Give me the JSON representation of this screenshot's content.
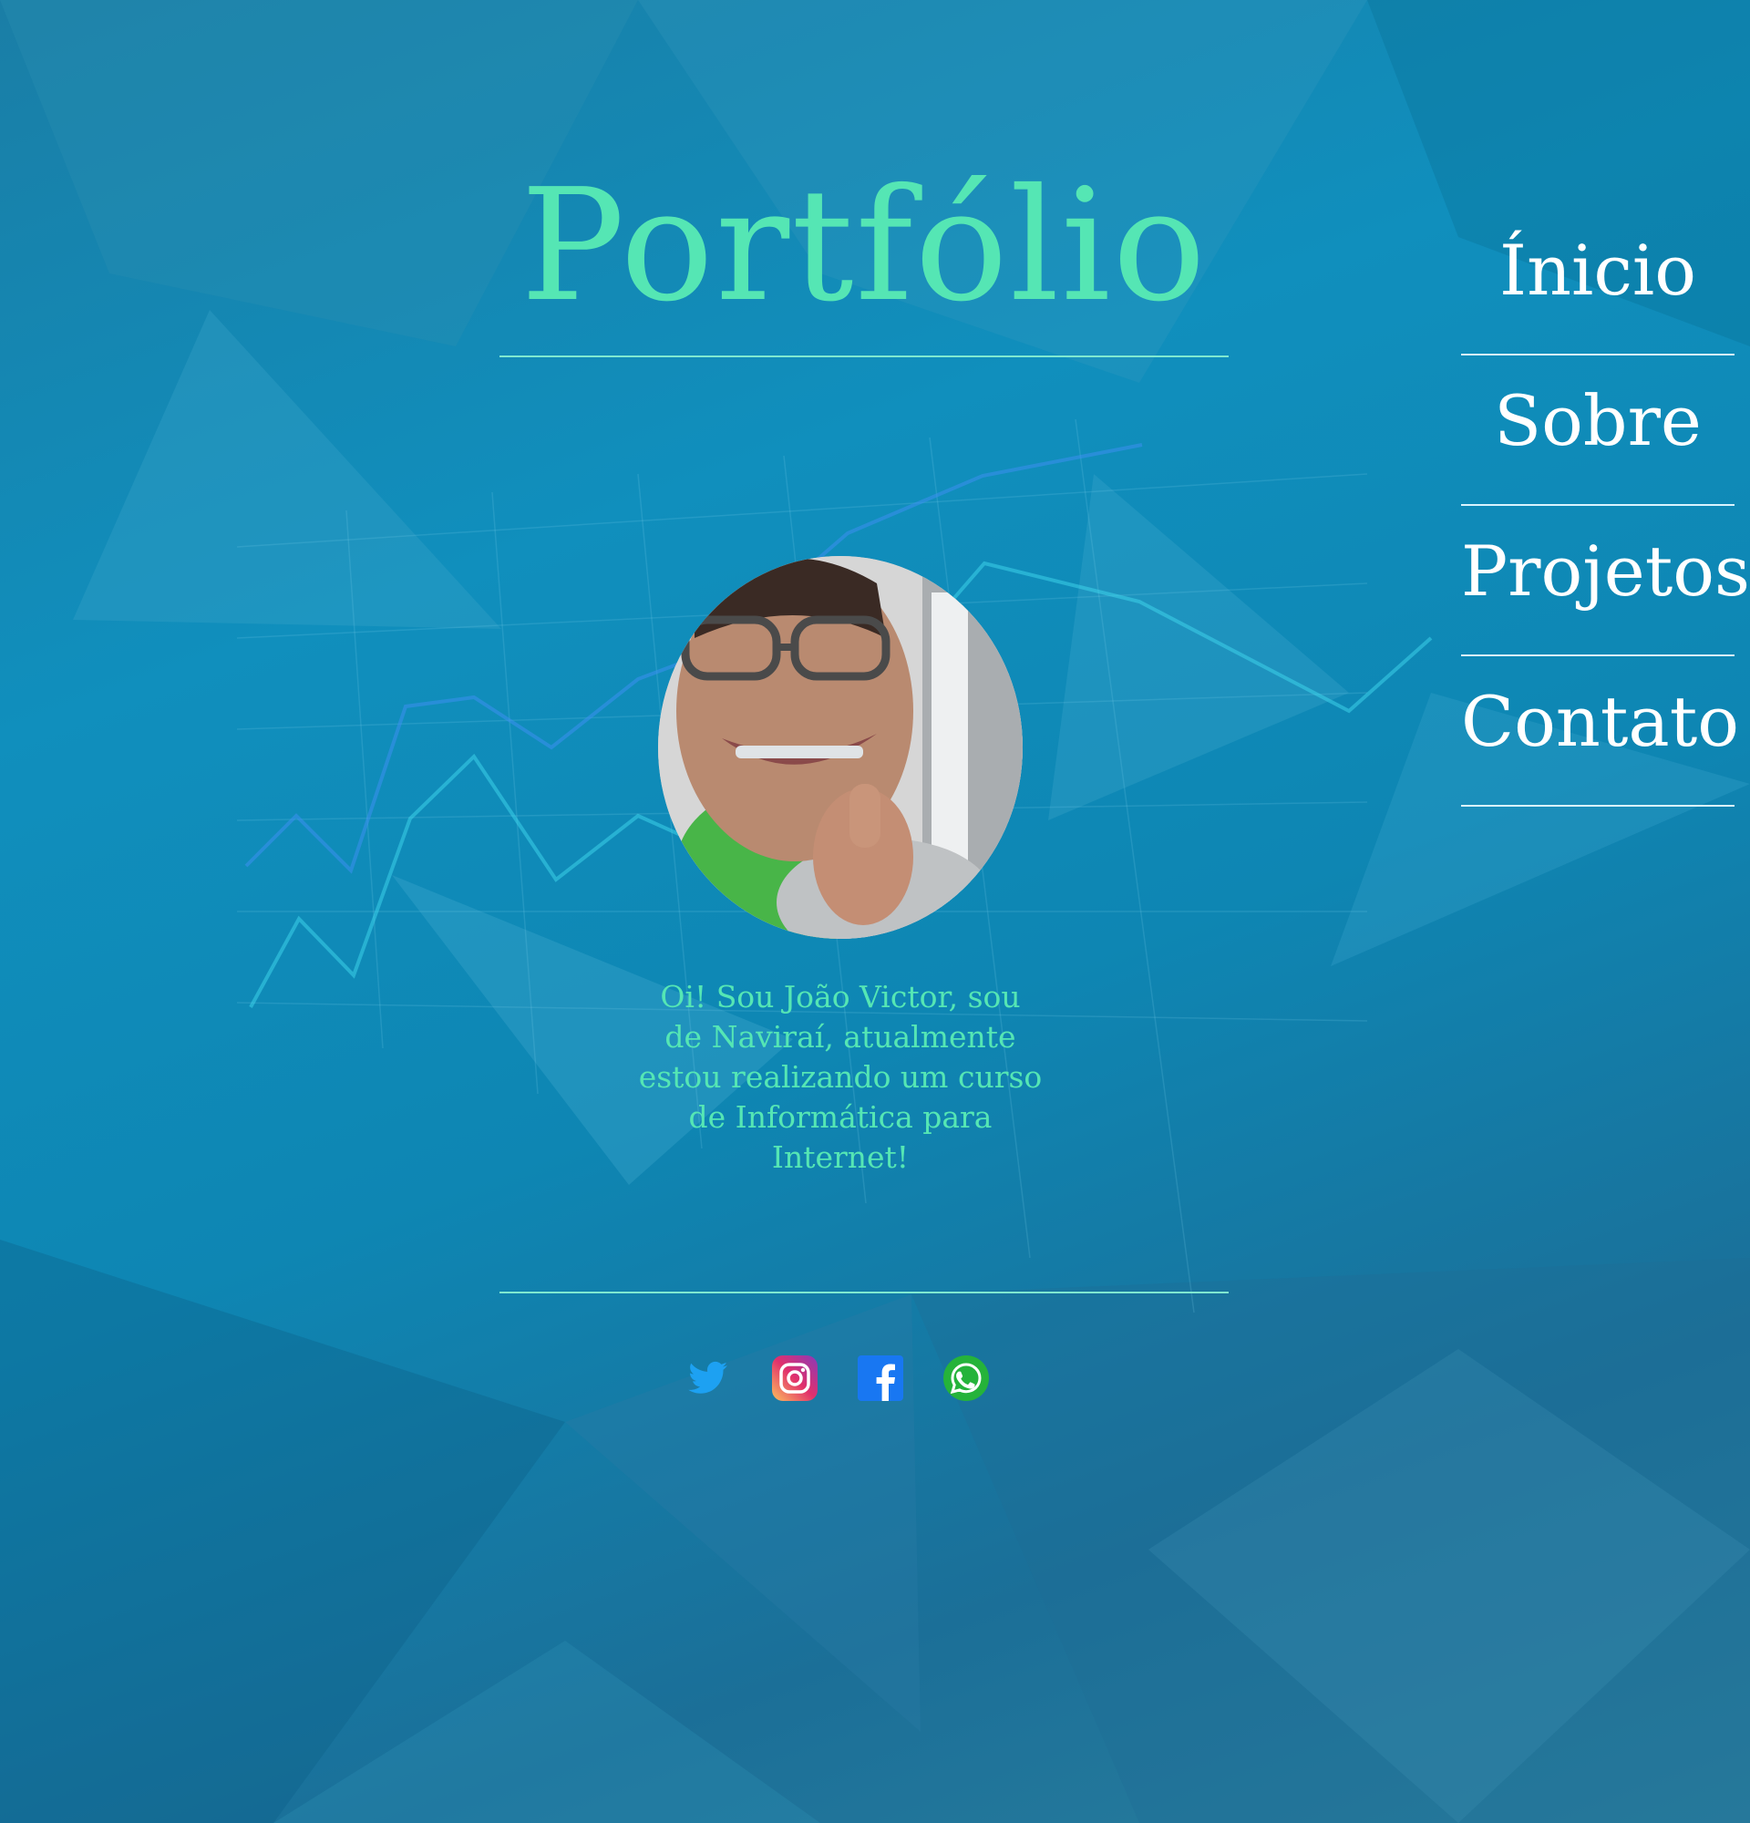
{
  "header": {
    "title": "Portfólio"
  },
  "nav": {
    "items": [
      {
        "label": "Ínicio"
      },
      {
        "label": "Sobre"
      },
      {
        "label": "Projetos"
      },
      {
        "label": "Contato"
      }
    ]
  },
  "profile": {
    "bio": "Oi! Sou João Victor, sou de Naviraí, atualmente estou realizando um curso de Informática para Internet!"
  },
  "social": [
    {
      "icon": "twitter-icon",
      "color": "#1da1f2"
    },
    {
      "icon": "instagram-icon",
      "color": "#e1306c"
    },
    {
      "icon": "facebook-icon",
      "color": "#1877f2"
    },
    {
      "icon": "whatsapp-icon",
      "color": "#25d366"
    }
  ],
  "colors": {
    "accent": "#55e6b4",
    "nav_text": "#ffffff",
    "rule": "#7fe8d0"
  }
}
